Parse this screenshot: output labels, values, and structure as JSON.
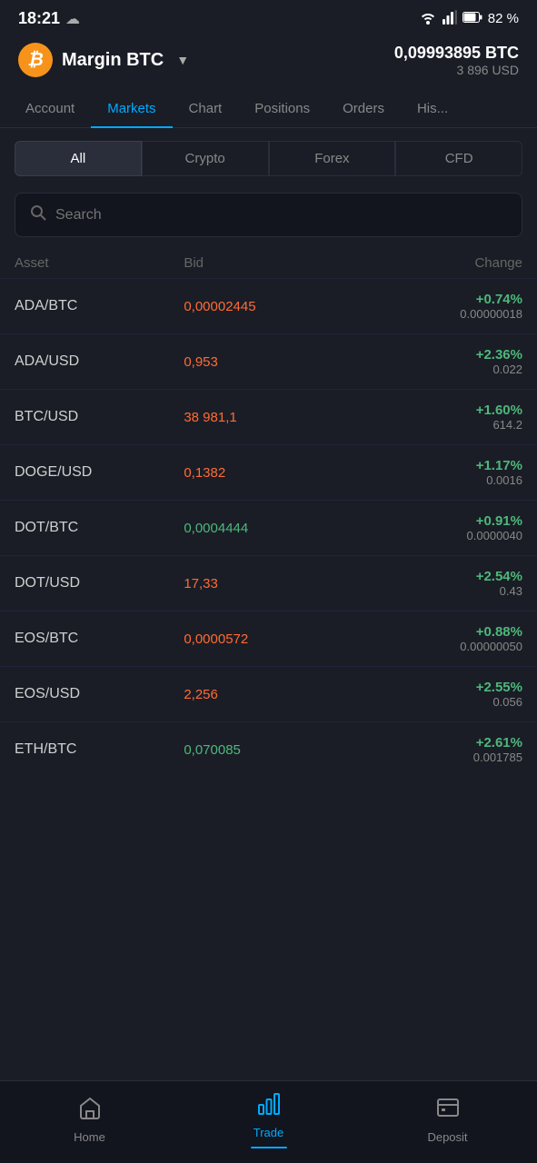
{
  "statusBar": {
    "time": "18:21",
    "battery": "82 %",
    "cloudIcon": "☁"
  },
  "header": {
    "accountType": "Margin BTC",
    "balanceBTC": "0,09993895 BTC",
    "balanceUSD": "3 896 USD"
  },
  "navTabs": [
    {
      "id": "account",
      "label": "Account",
      "active": false
    },
    {
      "id": "markets",
      "label": "Markets",
      "active": true
    },
    {
      "id": "chart",
      "label": "Chart",
      "active": false
    },
    {
      "id": "positions",
      "label": "Positions",
      "active": false
    },
    {
      "id": "orders",
      "label": "Orders",
      "active": false
    },
    {
      "id": "history",
      "label": "His...",
      "active": false
    }
  ],
  "filterButtons": [
    {
      "id": "all",
      "label": "All",
      "active": true
    },
    {
      "id": "crypto",
      "label": "Crypto",
      "active": false
    },
    {
      "id": "forex",
      "label": "Forex",
      "active": false
    },
    {
      "id": "cfd",
      "label": "CFD",
      "active": false
    }
  ],
  "search": {
    "placeholder": "Search"
  },
  "tableHeaders": {
    "asset": "Asset",
    "bid": "Bid",
    "change": "Change"
  },
  "assets": [
    {
      "name": "ADA/BTC",
      "bid": "0,00002445",
      "bidColor": "red",
      "changePct": "+0.74%",
      "changeAbs": "0.00000018"
    },
    {
      "name": "ADA/USD",
      "bid": "0,953",
      "bidColor": "red",
      "changePct": "+2.36%",
      "changeAbs": "0.022"
    },
    {
      "name": "BTC/USD",
      "bid": "38 981,1",
      "bidColor": "red",
      "changePct": "+1.60%",
      "changeAbs": "614.2"
    },
    {
      "name": "DOGE/USD",
      "bid": "0,1382",
      "bidColor": "red",
      "changePct": "+1.17%",
      "changeAbs": "0.0016"
    },
    {
      "name": "DOT/BTC",
      "bid": "0,0004444",
      "bidColor": "green",
      "changePct": "+0.91%",
      "changeAbs": "0.0000040"
    },
    {
      "name": "DOT/USD",
      "bid": "17,33",
      "bidColor": "red",
      "changePct": "+2.54%",
      "changeAbs": "0.43"
    },
    {
      "name": "EOS/BTC",
      "bid": "0,0000572",
      "bidColor": "red",
      "changePct": "+0.88%",
      "changeAbs": "0.00000050"
    },
    {
      "name": "EOS/USD",
      "bid": "2,256",
      "bidColor": "red",
      "changePct": "+2.55%",
      "changeAbs": "0.056"
    },
    {
      "name": "ETH/BTC",
      "bid": "0,070085",
      "bidColor": "green",
      "changePct": "+2.61%",
      "changeAbs": "0.001785"
    }
  ],
  "bottomNav": [
    {
      "id": "home",
      "label": "Home",
      "active": false
    },
    {
      "id": "trade",
      "label": "Trade",
      "active": true
    },
    {
      "id": "deposit",
      "label": "Deposit",
      "active": false
    }
  ]
}
